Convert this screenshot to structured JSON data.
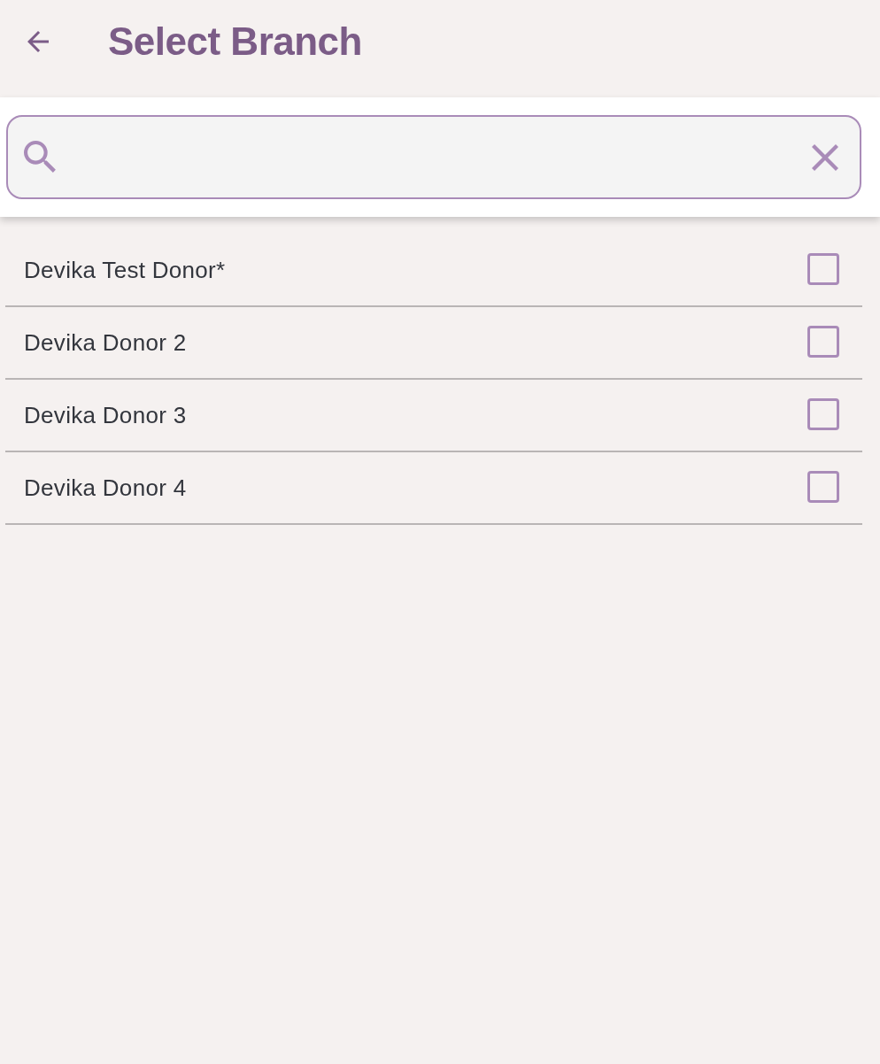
{
  "header": {
    "title": "Select Branch"
  },
  "branches": [
    {
      "name": "Devika Test Donor*",
      "checked": false
    },
    {
      "name": "Devika Donor 2",
      "checked": false
    },
    {
      "name": "Devika Donor 3",
      "checked": false
    },
    {
      "name": "Devika Donor 4",
      "checked": false
    }
  ]
}
